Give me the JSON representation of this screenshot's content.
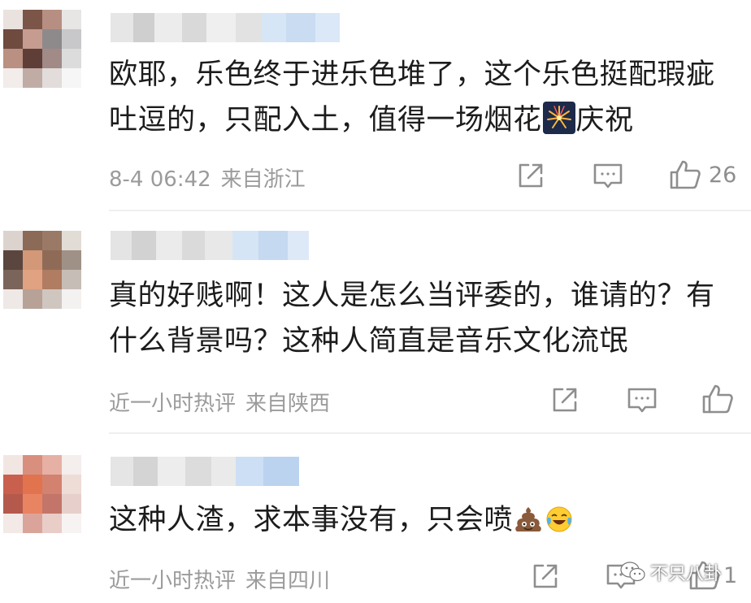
{
  "comments": [
    {
      "text_before_emoji": "欧耶，乐色终于进乐色堆了，这个乐色挺配瑕疵吐逗的，只配入土，值得一场烟花",
      "emoji": "fireworks",
      "text_after_emoji": "庆祝",
      "time": "8-4 06:42",
      "location": "来自浙江",
      "like_count": "26"
    },
    {
      "text": "真的好贱啊！这人是怎么当评委的，谁请的？有什么背景吗？这种人简直是音乐文化流氓",
      "time": "近一小时热评",
      "location": "来自陕西",
      "like_count": ""
    },
    {
      "text": "这种人渣，求本事没有，只会喷",
      "emojis": [
        "poop",
        "laughing-tears"
      ],
      "time": "近一小时热评",
      "location": "来自四川",
      "like_count": "1"
    }
  ],
  "watermark": {
    "text": "不只八卦",
    "icon": "wechat-icon"
  },
  "colors": {
    "text": "#1c1c1c",
    "meta": "#9b9b9b",
    "icon": "#8e8e8e",
    "divider": "#efefef",
    "username_blur": "#d8e6f7"
  }
}
